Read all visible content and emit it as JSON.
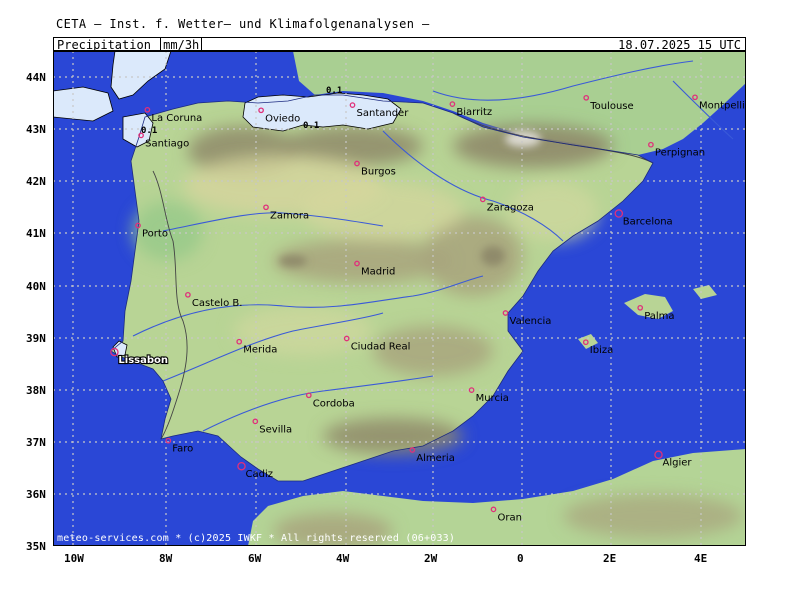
{
  "header": "CETA – Inst. f. Wetter– und Klimafolgenanalysen –",
  "title": {
    "label": "Precipitation_",
    "unit": "mm/3h",
    "datetime": "18.07.2025  15 UTC"
  },
  "footer": "meteo-services.com * (c)2025 IWKF * All rights reserved (06+033)",
  "y_axis": [
    "44N",
    "43N",
    "42N",
    "41N",
    "40N",
    "39N",
    "38N",
    "37N",
    "36N",
    "35N"
  ],
  "x_axis": [
    "10W",
    "8W",
    "6W",
    "4W",
    "2W",
    "0",
    "2E",
    "4E"
  ],
  "cities": [
    {
      "name": "La Coruna",
      "lon": -8.4,
      "lat": 43.37
    },
    {
      "name": "Oviedo",
      "lon": -5.85,
      "lat": 43.36
    },
    {
      "name": "Santander",
      "lon": -3.8,
      "lat": 43.46
    },
    {
      "name": "Biarritz",
      "lon": -1.56,
      "lat": 43.48
    },
    {
      "name": "Toulouse",
      "lon": 1.44,
      "lat": 43.6
    },
    {
      "name": "Montpellier",
      "lon": 3.88,
      "lat": 43.61
    },
    {
      "name": "Santiago",
      "lon": -8.54,
      "lat": 42.88
    },
    {
      "name": "Perpignan",
      "lon": 2.89,
      "lat": 42.7
    },
    {
      "name": "Burgos",
      "lon": -3.7,
      "lat": 42.34
    },
    {
      "name": "Zaragoza",
      "lon": -0.88,
      "lat": 41.65
    },
    {
      "name": "Barcelona",
      "lon": 2.17,
      "lat": 41.38
    },
    {
      "name": "Zamora",
      "lon": -5.74,
      "lat": 41.5
    },
    {
      "name": "Porto",
      "lon": -8.61,
      "lat": 41.15
    },
    {
      "name": "Madrid",
      "lon": -3.7,
      "lat": 40.42
    },
    {
      "name": "Castelo B.",
      "lon": -7.49,
      "lat": 39.82
    },
    {
      "name": "Valencia",
      "lon": -0.37,
      "lat": 39.47
    },
    {
      "name": "Palma",
      "lon": 2.65,
      "lat": 39.57
    },
    {
      "name": "Ibiza",
      "lon": 1.43,
      "lat": 38.91
    },
    {
      "name": "Merida",
      "lon": -6.34,
      "lat": 38.92
    },
    {
      "name": "Ciudad Real",
      "lon": -3.93,
      "lat": 38.98
    },
    {
      "name": "Lissabon",
      "lon": -9.14,
      "lat": 38.72
    },
    {
      "name": "Murcia",
      "lon": -1.13,
      "lat": 37.99
    },
    {
      "name": "Cordoba",
      "lon": -4.78,
      "lat": 37.89
    },
    {
      "name": "Sevilla",
      "lon": -5.98,
      "lat": 37.39
    },
    {
      "name": "Faro",
      "lon": -7.93,
      "lat": 37.02
    },
    {
      "name": "Almeria",
      "lon": -2.46,
      "lat": 36.84
    },
    {
      "name": "Algier",
      "lon": 3.06,
      "lat": 36.75
    },
    {
      "name": "Cadiz",
      "lon": -6.29,
      "lat": 36.53
    },
    {
      "name": "Oran",
      "lon": -0.64,
      "lat": 35.7
    }
  ],
  "precip_labels": [
    "0.1",
    "0.1",
    "0.1"
  ],
  "colors": {
    "sea": "#2a47d6",
    "land_low": "#9cc98c",
    "land_mid": "#cdd79d",
    "land_high": "#8f8a6a",
    "precip": "#dbe9fb",
    "city_marker": "#e0307a"
  }
}
